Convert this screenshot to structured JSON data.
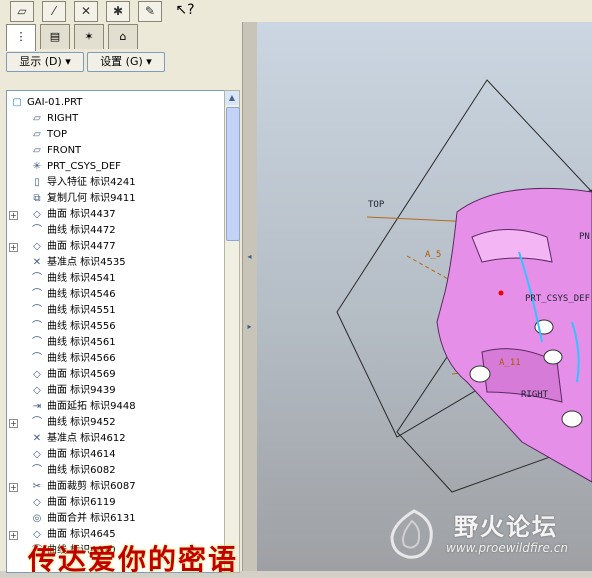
{
  "toolbar": {
    "buttons": [
      {
        "icon": "datum-plane-display-icon"
      },
      {
        "icon": "datum-axis-display-icon"
      },
      {
        "icon": "point-display-icon"
      },
      {
        "icon": "csys-display-icon"
      },
      {
        "icon": "annotation-display-icon"
      }
    ],
    "help_icon": "whats-this-help-icon"
  },
  "tabs": [
    {
      "icon": "model-tree-icon",
      "active": true
    },
    {
      "icon": "folder-browser-icon",
      "active": false
    },
    {
      "icon": "favorites-icon",
      "active": false
    },
    {
      "icon": "connections-icon",
      "active": false
    }
  ],
  "menus": {
    "display": "显示 (D) ▾",
    "settings": "设置 (G) ▾"
  },
  "tree": {
    "root": "GAI-01.PRT",
    "items": [
      {
        "label": "RIGHT",
        "icon": "datum-plane-icon",
        "expand": false
      },
      {
        "label": "TOP",
        "icon": "datum-plane-icon",
        "expand": false
      },
      {
        "label": "FRONT",
        "icon": "datum-plane-icon",
        "expand": false
      },
      {
        "label": "PRT_CSYS_DEF",
        "icon": "csys-icon",
        "expand": false
      },
      {
        "label": "导入特征 标识4241",
        "icon": "import-feature-icon",
        "expand": false
      },
      {
        "label": "复制几何 标识9411",
        "icon": "copy-geometry-icon",
        "expand": false
      },
      {
        "label": "曲面 标识4437",
        "icon": "surface-icon",
        "expand": true
      },
      {
        "label": "曲线 标识4472",
        "icon": "curve-icon",
        "expand": false
      },
      {
        "label": "曲面 标识4477",
        "icon": "surface-icon",
        "expand": true
      },
      {
        "label": "基准点 标识4535",
        "icon": "datum-point-icon",
        "expand": false
      },
      {
        "label": "曲线 标识4541",
        "icon": "curve-icon",
        "expand": false
      },
      {
        "label": "曲线 标识4546",
        "icon": "curve-icon",
        "expand": false
      },
      {
        "label": "曲线 标识4551",
        "icon": "curve-icon",
        "expand": false
      },
      {
        "label": "曲线 标识4556",
        "icon": "curve-icon",
        "expand": false
      },
      {
        "label": "曲线 标识4561",
        "icon": "curve-icon",
        "expand": false
      },
      {
        "label": "曲线 标识4566",
        "icon": "curve-icon",
        "expand": false
      },
      {
        "label": "曲面 标识4569",
        "icon": "surface-icon",
        "expand": false
      },
      {
        "label": "曲面 标识9439",
        "icon": "surface-icon",
        "expand": false
      },
      {
        "label": "曲面延拓 标识9448",
        "icon": "extend-icon",
        "expand": false
      },
      {
        "label": "曲线 标识9452",
        "icon": "curve-icon",
        "expand": true
      },
      {
        "label": "基准点 标识4612",
        "icon": "datum-point-icon",
        "expand": false
      },
      {
        "label": "曲面 标识4614",
        "icon": "surface-icon",
        "expand": false
      },
      {
        "label": "曲线 标识6082",
        "icon": "curve-icon",
        "expand": false
      },
      {
        "label": "曲面裁剪 标识6087",
        "icon": "trim-icon",
        "expand": true
      },
      {
        "label": "曲面 标识6119",
        "icon": "surface-icon",
        "expand": false
      },
      {
        "label": "曲面合并 标识6131",
        "icon": "merge-icon",
        "expand": false
      },
      {
        "label": "曲面 标识4645",
        "icon": "surface-icon",
        "expand": true
      },
      {
        "label": "曲线 标识4670",
        "icon": "curve-icon",
        "expand": false
      }
    ]
  },
  "viewport": {
    "datum_planes": [
      "TOP",
      "RIGHT"
    ],
    "axes": [
      "A_5",
      "A_11"
    ],
    "csys": "PRT_CSYS_DEF",
    "partial_label": "PN",
    "model_color": "#e58ee8"
  },
  "logo": {
    "title": "野火论坛",
    "url": "www.proewildfire.cn"
  },
  "subtitle": "传达爱你的密语"
}
